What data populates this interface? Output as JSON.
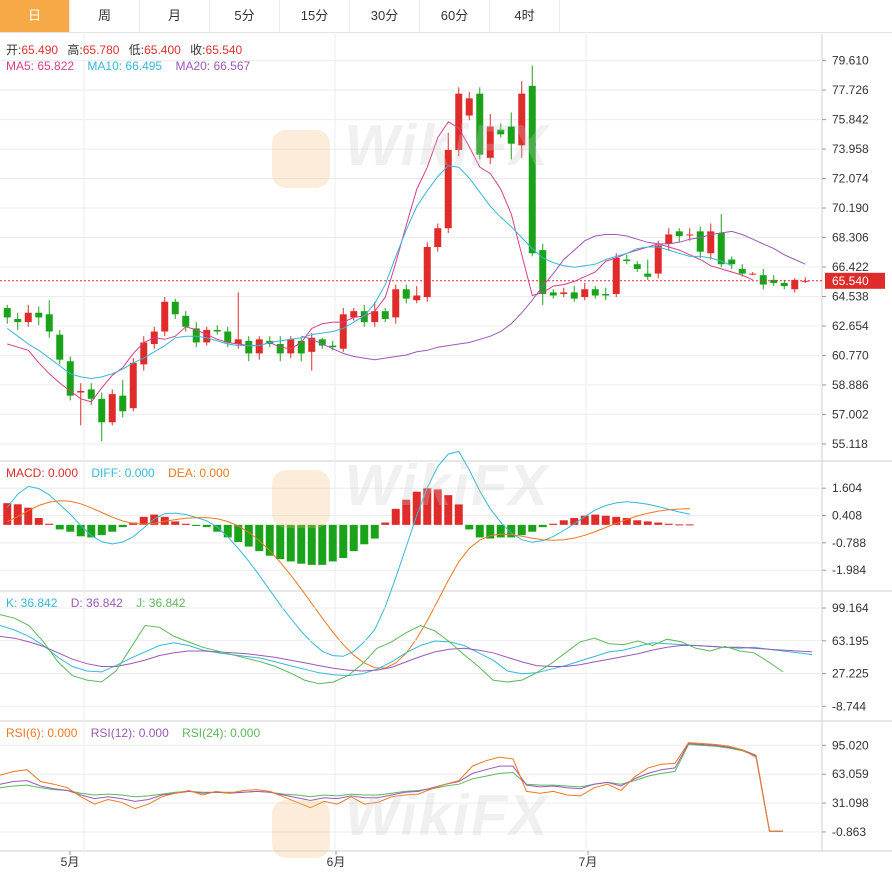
{
  "tabs": [
    "日",
    "周",
    "月",
    "5分",
    "15分",
    "30分",
    "60分",
    "4时"
  ],
  "active_tab": 0,
  "header": {
    "open_label": "开:",
    "open": "65.490",
    "high_label": "高:",
    "high": "65.780",
    "low_label": "低:",
    "low": "65.400",
    "close_label": "收:",
    "close": "65.540",
    "ma5": "MA5: 65.822",
    "ma10": "MA10: 66.495",
    "ma20": "MA20: 66.567"
  },
  "price_tag": "65.540",
  "watermark": "WikiFX",
  "colors": {
    "up": "#e02b2b",
    "down": "#1aa31a",
    "ma5": "#d4408a",
    "ma10": "#35b8d8",
    "ma20": "#9b59b6",
    "macd": "#f07820",
    "grid": "#ececec",
    "tag": "#e02b2b"
  },
  "chart_data": {
    "type": "candlestick",
    "x_labels": [
      {
        "label": "5月",
        "index": 5
      },
      {
        "label": "6月",
        "index": 27
      },
      {
        "label": "7月",
        "index": 48
      }
    ],
    "main": {
      "ylim": [
        54.6,
        80.8
      ],
      "yticks": [
        "79.610",
        "77.726",
        "75.842",
        "73.958",
        "72.074",
        "70.190",
        "68.306",
        "66.422",
        "64.538",
        "62.654",
        "60.770",
        "58.886",
        "57.002",
        "55.118"
      ],
      "candles": [
        [
          63.8,
          63.2,
          64.0,
          62.8
        ],
        [
          63.1,
          62.9,
          63.5,
          62.4
        ],
        [
          62.9,
          63.5,
          64.0,
          62.6
        ],
        [
          63.5,
          63.2,
          63.9,
          62.7
        ],
        [
          63.4,
          62.3,
          64.3,
          61.9
        ],
        [
          62.1,
          60.5,
          62.4,
          60.2
        ],
        [
          60.4,
          58.2,
          60.7,
          57.9
        ],
        [
          58.4,
          58.5,
          59.0,
          56.3
        ],
        [
          58.6,
          58.0,
          59.0,
          57.6
        ],
        [
          58.0,
          56.5,
          58.4,
          55.3
        ],
        [
          56.5,
          58.3,
          58.6,
          56.3
        ],
        [
          58.2,
          57.2,
          59.2,
          56.8
        ],
        [
          57.4,
          60.3,
          60.6,
          57.2
        ],
        [
          60.2,
          61.6,
          62.0,
          59.8
        ],
        [
          61.5,
          62.3,
          62.6,
          61.2
        ],
        [
          62.3,
          64.2,
          64.5,
          62.0
        ],
        [
          64.2,
          63.4,
          64.4,
          63.1
        ],
        [
          63.3,
          62.6,
          63.6,
          62.3
        ],
        [
          62.5,
          61.6,
          62.9,
          61.3
        ],
        [
          61.6,
          62.4,
          62.6,
          61.4
        ],
        [
          62.4,
          62.3,
          62.7,
          62.1
        ],
        [
          62.3,
          61.6,
          62.6,
          61.3
        ],
        [
          61.5,
          61.8,
          64.8,
          61.2
        ],
        [
          61.7,
          60.9,
          62.0,
          60.4
        ],
        [
          60.9,
          61.8,
          62.0,
          60.5
        ],
        [
          61.7,
          61.5,
          62.0,
          61.3
        ],
        [
          61.5,
          60.9,
          62.0,
          60.4
        ],
        [
          60.9,
          61.8,
          62.0,
          60.6
        ],
        [
          61.7,
          60.9,
          61.9,
          60.4
        ],
        [
          61.0,
          61.9,
          62.2,
          59.8
        ],
        [
          61.8,
          61.4,
          61.9,
          61.2
        ],
        [
          61.4,
          61.3,
          61.7,
          61.1
        ],
        [
          61.2,
          63.4,
          63.8,
          61.0
        ],
        [
          63.2,
          63.6,
          63.8,
          63.0
        ],
        [
          63.6,
          62.9,
          64.0,
          62.6
        ],
        [
          62.9,
          63.6,
          64.2,
          62.6
        ],
        [
          63.6,
          63.1,
          63.8,
          62.9
        ],
        [
          63.2,
          65.0,
          65.3,
          62.8
        ],
        [
          65.0,
          64.4,
          65.3,
          64.1
        ],
        [
          64.3,
          64.6,
          65.2,
          64.1
        ],
        [
          64.5,
          67.7,
          68.0,
          64.2
        ],
        [
          67.7,
          68.9,
          69.2,
          67.4
        ],
        [
          68.9,
          73.9,
          75.0,
          68.6
        ],
        [
          73.9,
          77.5,
          77.9,
          73.5
        ],
        [
          76.1,
          77.2,
          77.6,
          75.8
        ],
        [
          77.5,
          73.6,
          77.9,
          73.3
        ],
        [
          73.4,
          75.4,
          76.2,
          73.0
        ],
        [
          75.2,
          74.9,
          75.6,
          74.7
        ],
        [
          75.4,
          74.3,
          76.3,
          73.3
        ],
        [
          74.2,
          77.5,
          78.3,
          73.4
        ],
        [
          78.0,
          67.3,
          79.3,
          67.1
        ],
        [
          67.5,
          64.7,
          67.9,
          64.0
        ],
        [
          64.8,
          64.6,
          65.0,
          64.4
        ],
        [
          64.7,
          64.8,
          65.1,
          64.5
        ],
        [
          64.8,
          64.4,
          65.2,
          64.2
        ],
        [
          64.5,
          65.0,
          65.4,
          64.3
        ],
        [
          65.0,
          64.6,
          65.2,
          64.4
        ],
        [
          64.7,
          64.6,
          65.1,
          64.3
        ],
        [
          64.7,
          67.0,
          67.3,
          64.5
        ],
        [
          66.9,
          66.8,
          67.2,
          66.6
        ],
        [
          66.6,
          66.3,
          66.8,
          66.1
        ],
        [
          66.0,
          65.8,
          66.9,
          65.6
        ],
        [
          66.0,
          67.8,
          68.1,
          65.7
        ],
        [
          67.9,
          68.5,
          68.9,
          67.5
        ],
        [
          68.7,
          68.4,
          68.9,
          68.0
        ],
        [
          68.5,
          68.5,
          68.9,
          68.1
        ],
        [
          68.7,
          67.4,
          69.0,
          67.0
        ],
        [
          67.3,
          68.7,
          69.2,
          66.9
        ],
        [
          68.6,
          66.6,
          69.8,
          66.4
        ],
        [
          66.9,
          66.6,
          67.1,
          66.3
        ],
        [
          66.3,
          66.0,
          66.6,
          65.8
        ],
        [
          66.0,
          66.0,
          66.1,
          65.9
        ],
        [
          65.9,
          65.3,
          66.3,
          65.0
        ],
        [
          65.6,
          65.4,
          65.9,
          65.2
        ],
        [
          65.4,
          65.2,
          65.6,
          65.0
        ],
        [
          65.0,
          65.6,
          65.7,
          64.8
        ],
        [
          65.49,
          65.54,
          65.78,
          65.4
        ]
      ],
      "ma5": [
        61.5,
        61.3,
        61.1,
        60.3,
        59.6,
        59.0,
        58.5,
        58.0,
        57.8,
        58.7,
        59.5,
        60.0,
        60.9,
        61.6,
        61.9,
        61.8,
        62.0,
        62.6,
        62.4,
        62.1,
        61.8,
        61.6,
        61.5,
        61.4,
        61.4,
        61.6,
        61.3,
        61.2,
        61.6,
        62.5,
        62.8,
        62.9,
        62.9,
        63.2,
        63.3,
        63.6,
        64.5,
        66.7,
        69.1,
        71.4,
        72.8,
        74.7,
        75.7,
        75.3,
        74.1,
        72.8,
        72.4,
        71.4,
        69.8,
        67.2,
        64.6,
        64.8,
        65.2,
        65.3,
        65.5,
        65.8,
        66.1,
        66.8,
        67.0,
        67.3,
        67.5,
        67.7,
        67.9,
        67.7,
        67.5,
        67.2,
        66.9,
        66.5,
        66.3,
        66.1,
        65.9,
        65.6
      ],
      "ma10": [
        62.5,
        62.0,
        61.5,
        61.1,
        60.6,
        60.1,
        59.6,
        59.4,
        59.3,
        59.4,
        59.6,
        59.9,
        60.3,
        60.6,
        61.0,
        61.4,
        61.9,
        62.0,
        62.0,
        61.9,
        61.7,
        61.5,
        61.4,
        61.4,
        61.4,
        61.6,
        61.7,
        61.8,
        61.9,
        62.1,
        62.2,
        62.3,
        62.5,
        62.9,
        63.3,
        64.1,
        65.3,
        67.1,
        68.8,
        70.3,
        71.3,
        72.2,
        72.9,
        72.8,
        72.1,
        71.2,
        70.3,
        69.6,
        69.0,
        68.3,
        67.6,
        67.0,
        66.7,
        66.5,
        66.4,
        66.5,
        66.6,
        66.9,
        67.1,
        67.3,
        67.6,
        67.7,
        67.7,
        67.5,
        67.3,
        67.1,
        67.1,
        67.0,
        66.8,
        66.5
      ],
      "ma20": [
        62.0,
        61.8,
        61.5,
        61.2,
        60.9,
        60.7,
        60.6,
        60.5,
        60.6,
        60.7,
        60.8,
        61.0,
        61.1,
        61.3,
        61.4,
        61.5,
        61.6,
        61.8,
        62.0,
        62.3,
        62.8,
        63.5,
        64.3,
        65.2,
        66.0,
        66.9,
        67.5,
        68.1,
        68.4,
        68.5,
        68.5,
        68.4,
        68.2,
        68.0,
        67.9,
        67.9,
        68.0,
        68.2,
        68.3,
        68.5,
        68.6,
        68.7,
        68.5,
        68.2,
        67.9,
        67.6,
        67.2,
        66.9,
        66.6
      ]
    },
    "macd": {
      "label_macd": "MACD: 0.000",
      "label_diff": "DIFF: 0.000",
      "label_dea": "DEA: 0.000",
      "ylim": [
        -2.5,
        2.4
      ],
      "yticks": [
        "1.604",
        "0.408",
        "-0.788",
        "-1.984"
      ],
      "hist": [
        0.95,
        0.9,
        0.75,
        0.3,
        0.05,
        -0.2,
        -0.3,
        -0.5,
        -0.55,
        -0.45,
        -0.3,
        -0.1,
        0.1,
        0.35,
        0.45,
        0.35,
        0.15,
        0.05,
        -0.05,
        -0.1,
        -0.3,
        -0.55,
        -0.75,
        -0.95,
        -1.15,
        -1.35,
        -1.5,
        -1.6,
        -1.7,
        -1.75,
        -1.75,
        -1.6,
        -1.45,
        -1.15,
        -0.85,
        -0.6,
        0.1,
        0.7,
        1.1,
        1.45,
        1.6,
        1.55,
        1.3,
        0.9,
        -0.2,
        -0.55,
        -0.6,
        -0.55,
        -0.55,
        -0.45,
        -0.3,
        -0.1,
        0.05,
        0.2,
        0.3,
        0.4,
        0.45,
        0.4,
        0.35,
        0.3,
        0.2,
        0.15,
        0.1,
        0.05,
        0.02,
        0.02
      ]
    },
    "kdj": {
      "label_k": "K: 36.842",
      "label_d": "D: 36.842",
      "label_j": "J: 36.842",
      "ylim": [
        -15,
        108
      ],
      "yticks": [
        "99.164",
        "63.195",
        "27.225",
        "-8.744"
      ],
      "k": [
        80,
        75,
        68,
        58,
        45,
        35,
        30,
        29,
        36,
        44,
        51,
        58,
        61,
        58,
        53,
        50,
        48,
        46,
        44,
        40,
        36,
        32,
        28,
        26,
        25,
        27,
        32,
        40,
        50,
        58,
        63,
        62,
        58,
        50,
        42,
        30,
        27,
        28,
        32,
        36,
        41,
        46,
        51,
        53,
        57,
        61,
        60,
        59,
        58,
        57,
        56,
        55,
        56,
        54,
        52,
        50,
        48
      ],
      "d": [
        68,
        66,
        62,
        57,
        50,
        43,
        38,
        35,
        35,
        38,
        42,
        47,
        50,
        52,
        52,
        51,
        50,
        49,
        47,
        45,
        42,
        39,
        36,
        33,
        31,
        30,
        31,
        34,
        40,
        46,
        51,
        54,
        55,
        53,
        50,
        45,
        40,
        36,
        35,
        35,
        37,
        40,
        43,
        46,
        49,
        53,
        56,
        58,
        58,
        57,
        56,
        56,
        55,
        54,
        53,
        52,
        51
      ],
      "j": [
        92,
        88,
        80,
        62,
        40,
        25,
        20,
        18,
        30,
        55,
        80,
        78,
        68,
        62,
        56,
        52,
        48,
        44,
        40,
        35,
        28,
        20,
        16,
        18,
        25,
        38,
        55,
        62,
        72,
        80,
        74,
        62,
        48,
        35,
        20,
        18,
        20,
        28,
        38,
        50,
        62,
        66,
        60,
        59,
        63,
        58,
        65,
        62,
        55,
        52,
        57,
        52,
        50,
        40,
        29
      ]
    },
    "rsi": {
      "label_6": "RSI(6): 0.000",
      "label_12": "RSI(12): 0.000",
      "label_24": "RSI(24): 0.000",
      "ylim": [
        -12,
        112
      ],
      "yticks": [
        "95.020",
        "63.059",
        "31.098",
        "-0.863"
      ],
      "rsi6": [
        62,
        66,
        68,
        55,
        52,
        48,
        38,
        30,
        35,
        32,
        25,
        30,
        38,
        42,
        45,
        40,
        44,
        42,
        45,
        46,
        44,
        38,
        32,
        26,
        33,
        30,
        38,
        30,
        32,
        38,
        40,
        41,
        47,
        52,
        56,
        72,
        78,
        82,
        80,
        44,
        42,
        44,
        40,
        39,
        48,
        52,
        45,
        60,
        70,
        74,
        75,
        98,
        97,
        96,
        94,
        90,
        82,
        0,
        0
      ],
      "rsi12": [
        52,
        55,
        56,
        50,
        47,
        45,
        40,
        36,
        38,
        36,
        33,
        35,
        40,
        42,
        44,
        42,
        43,
        42,
        43,
        44,
        43,
        40,
        37,
        34,
        37,
        36,
        39,
        37,
        37,
        40,
        43,
        44,
        48,
        52,
        55,
        64,
        68,
        72,
        72,
        51,
        49,
        50,
        48,
        47,
        52,
        54,
        50,
        58,
        64,
        68,
        70,
        97,
        96,
        95,
        93,
        90,
        84,
        0,
        0
      ],
      "rsi24": [
        48,
        50,
        51,
        48,
        46,
        45,
        42,
        40,
        41,
        40,
        38,
        39,
        41,
        43,
        44,
        43,
        43,
        43,
        43,
        44,
        43,
        41,
        40,
        38,
        40,
        39,
        41,
        40,
        40,
        42,
        44,
        45,
        47,
        50,
        52,
        58,
        61,
        64,
        65,
        52,
        51,
        51,
        50,
        49,
        52,
        54,
        52,
        56,
        61,
        64,
        66,
        96,
        95,
        94,
        92,
        89,
        83,
        0,
        0
      ]
    }
  }
}
